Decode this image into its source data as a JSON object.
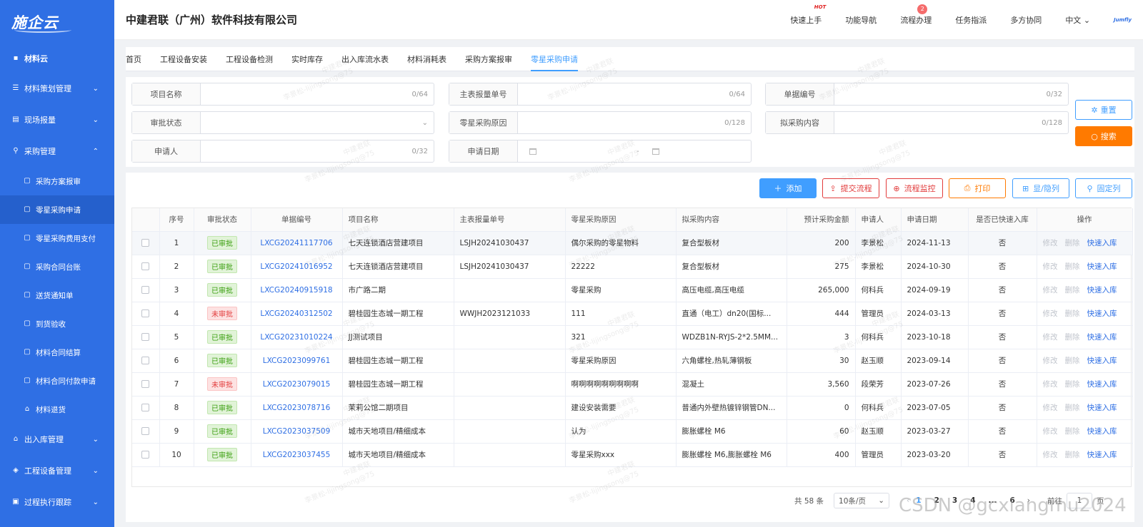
{
  "sidebar": {
    "logo": "施企云",
    "top_item": "材料云",
    "groups": [
      {
        "label": "材料策划管理"
      },
      {
        "label": "现场报量"
      },
      {
        "label": "采购管理"
      }
    ],
    "sub_items": [
      {
        "label": "采购方案报审"
      },
      {
        "label": "零星采购申请"
      },
      {
        "label": "零星采购费用支付"
      },
      {
        "label": "采购合同台账"
      },
      {
        "label": "送货通知单"
      },
      {
        "label": "到货验收"
      },
      {
        "label": "材料合同结算"
      },
      {
        "label": "材料合同付款申请"
      },
      {
        "label": "材料退货"
      }
    ],
    "bottom_groups": [
      {
        "label": "出入库管理"
      },
      {
        "label": "工程设备管理"
      },
      {
        "label": "过程执行跟踪"
      }
    ]
  },
  "header": {
    "company": "中建君联（广州）软件科技有限公司",
    "nav": [
      "快速上手",
      "功能导航",
      "流程办理",
      "任务指派",
      "多方协同",
      "中文"
    ],
    "hot_label": "HOT",
    "badge_count": "2",
    "brand_mini": "Jumfly"
  },
  "tabs": [
    "首页",
    "工程设备安装",
    "工程设备检测",
    "实时库存",
    "出入库流水表",
    "材料消耗表",
    "采购方案报审",
    "零星采购申请"
  ],
  "filters": {
    "project_name": {
      "label": "项目名称",
      "count": "0/64"
    },
    "main_report_no": {
      "label": "主表报量单号",
      "count": "0/64"
    },
    "doc_no": {
      "label": "单据编号",
      "count": "0/32"
    },
    "approval_status": {
      "label": "审批状态"
    },
    "reason": {
      "label": "零星采购原因",
      "count": "0/128"
    },
    "content": {
      "label": "拟采购内容",
      "count": "0/128"
    },
    "applicant": {
      "label": "申请人",
      "count": "0/32"
    },
    "apply_date": {
      "label": "申请日期",
      "sep": "-"
    },
    "reset_label": "重置",
    "search_label": "搜索"
  },
  "toolbar": {
    "add": "添加",
    "submit_flow": "提交流程",
    "flow_monitor": "流程监控",
    "print": "打印",
    "show_hide": "显/隐列",
    "fix_col": "固定列"
  },
  "table": {
    "headers": [
      "",
      "序号",
      "审批状态",
      "单据编号",
      "项目名称",
      "主表报量单号",
      "零星采购原因",
      "拟采购内容",
      "预计采购金额",
      "申请人",
      "申请日期",
      "是否已快速入库",
      "操作"
    ],
    "ops": {
      "edit": "修改",
      "delete": "删除",
      "quick_in": "快速入库"
    },
    "rows": [
      {
        "no": "1",
        "status": "已审批",
        "code": "LXCG20241117706",
        "project": "七天连锁酒店营建项目",
        "main_no": "LSJH20241030437",
        "reason": "偶尔采购的零星物料",
        "content": "复合型板材",
        "amount": "200",
        "applicant": "李景松",
        "date": "2024-11-13",
        "quick": "否"
      },
      {
        "no": "2",
        "status": "已审批",
        "code": "LXCG20241016952",
        "project": "七天连锁酒店营建项目",
        "main_no": "LSJH20241030437",
        "reason": "22222",
        "content": "复合型板材",
        "amount": "275",
        "applicant": "李景松",
        "date": "2024-10-30",
        "quick": "否"
      },
      {
        "no": "3",
        "status": "已审批",
        "code": "LXCG20240915918",
        "project": "市广路二期",
        "main_no": "",
        "reason": "零星采购",
        "content": "高压电缆,高压电缆",
        "amount": "265,000",
        "applicant": "何科兵",
        "date": "2024-09-19",
        "quick": "否"
      },
      {
        "no": "4",
        "status": "未审批",
        "code": "LXCG20240312502",
        "project": "碧桂园生态城一期工程",
        "main_no": "WWJH2023121033",
        "reason": "111",
        "content": "直通（电工）dn20(国标...",
        "amount": "444",
        "applicant": "管理员",
        "date": "2024-03-13",
        "quick": "否"
      },
      {
        "no": "5",
        "status": "已审批",
        "code": "LXCG20231010224",
        "project": "JJ测试项目",
        "main_no": "",
        "reason": "321",
        "content": "WDZB1N-RYJS-2*2.5MM...",
        "amount": "3",
        "applicant": "何科兵",
        "date": "2023-10-18",
        "quick": "否"
      },
      {
        "no": "6",
        "status": "已审批",
        "code": "LXCG2023099761",
        "project": "碧桂园生态城一期工程",
        "main_no": "",
        "reason": "零星采购原因",
        "content": "六角螺栓,热轧薄钢板",
        "amount": "30",
        "applicant": "赵玉顺",
        "date": "2023-09-14",
        "quick": "否"
      },
      {
        "no": "7",
        "status": "未审批",
        "code": "LXCG2023079015",
        "project": "碧桂园生态城一期工程",
        "main_no": "",
        "reason": "啊啊啊啊啊啊啊啊啊",
        "content": "混凝土",
        "amount": "3,560",
        "applicant": "段荣芳",
        "date": "2023-07-26",
        "quick": "否"
      },
      {
        "no": "8",
        "status": "已审批",
        "code": "LXCG2023078716",
        "project": "茉莉公馆二期项目",
        "main_no": "",
        "reason": "建设安装需要",
        "content": "普通内外壁热镀锌钢管DN...",
        "amount": "0",
        "applicant": "何科兵",
        "date": "2023-07-05",
        "quick": "否"
      },
      {
        "no": "9",
        "status": "已审批",
        "code": "LXCG2023037509",
        "project": "城市天地项目/精细成本",
        "main_no": "",
        "reason": "认为",
        "content": "膨胀螺栓 M6",
        "amount": "60",
        "applicant": "赵玉顺",
        "date": "2023-03-27",
        "quick": "否"
      },
      {
        "no": "10",
        "status": "已审批",
        "code": "LXCG2023037455",
        "project": "城市天地项目/精细成本",
        "main_no": "",
        "reason": "零星采购xxx",
        "content": "膨胀螺栓 M6,膨胀螺栓 M6",
        "amount": "400",
        "applicant": "管理员",
        "date": "2023-03-20",
        "quick": "否"
      }
    ]
  },
  "pagination": {
    "total": "共 58 条",
    "page_size": "10条/页",
    "pages": [
      "1",
      "2",
      "3",
      "4",
      "...",
      "6"
    ],
    "goto_label": "前往",
    "goto_value": "1",
    "page_suffix": "页"
  },
  "watermark": {
    "line1": "中建君联",
    "line2": "李景松-lijingsong@75"
  },
  "overlay_text": "CSDN @gcxiangmu2024",
  "colors": {
    "sidebar": "#2f6fe4",
    "primary": "#409eff",
    "search": "#ff7a00",
    "danger": "#e23c3c"
  }
}
